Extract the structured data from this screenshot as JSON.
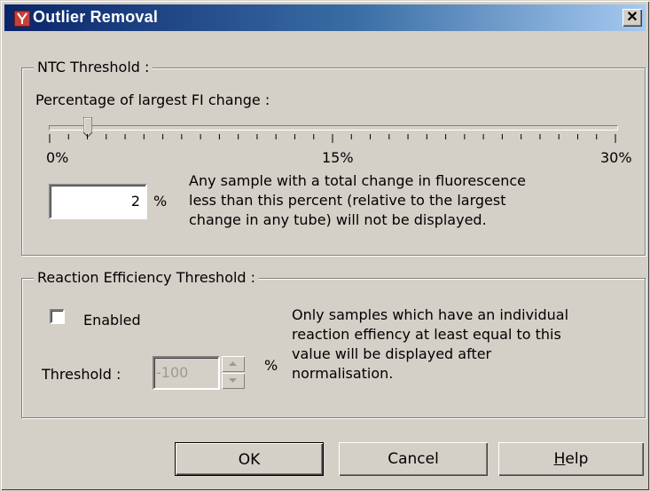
{
  "window": {
    "title": "Outlier Removal",
    "close_glyph": "✕",
    "icon": "app-icon"
  },
  "ntc": {
    "group_label": "NTC Threshold :",
    "slider_label": "Percentage of largest FI change :",
    "slider_value_percent": 2,
    "slider_max_percent": 30,
    "tick_labels": [
      "0%",
      "15%",
      "30%"
    ],
    "value": "2",
    "unit": "%",
    "description": "Any sample with a total change in fluorescence\nless than this percent (relative to the largest\nchange in any tube) will not be displayed."
  },
  "efficiency": {
    "group_label": "Reaction Efficiency Threshold :",
    "enabled_label": "Enabled",
    "enabled_checked": false,
    "threshold_label": "Threshold :",
    "threshold_value": "-100",
    "unit": "%",
    "description": "Only samples which have an individual\nreaction effiency at least equal to this\nvalue will be displayed after\nnormalisation."
  },
  "buttons": {
    "ok": "OK",
    "cancel": "Cancel",
    "help_prefix": "H",
    "help_rest": "elp"
  },
  "colors": {
    "face": "#d4d0c8",
    "title_start": "#0a246a",
    "title_end": "#a6caf0"
  }
}
